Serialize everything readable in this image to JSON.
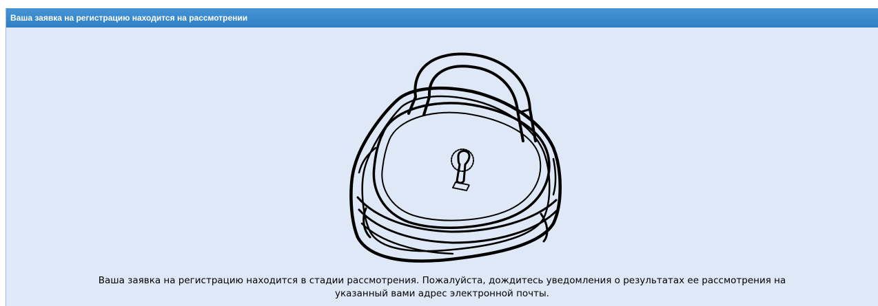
{
  "panel": {
    "title": "Ваша заявка на регистрацию находится на рассмотрении",
    "header_color": "#3d8bcd",
    "body_color": "#dfe8f6"
  },
  "illustration": {
    "icon": "padlock-icon"
  },
  "message": {
    "line1": "Ваша заявка на регистрацию находится в стадии рассмотрения. Пожалуйста, дождитесь уведомления о результатах ее рассмотрения на",
    "line2": "указанный вами адрес электронной почты."
  }
}
